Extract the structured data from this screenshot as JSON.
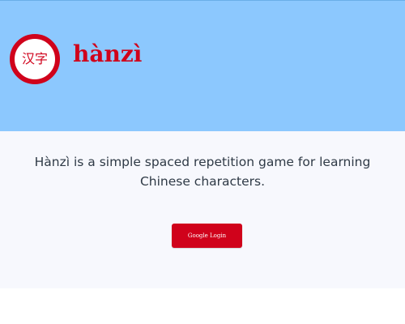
{
  "header": {
    "logo_text": "汉字",
    "brand_name": "hànzì"
  },
  "main": {
    "description": "Hànzì is a simple spaced repetition game for learning Chinese characters.",
    "login_button_label": "Google Login"
  },
  "colors": {
    "header_background": "#8cc8fe",
    "brand_red": "#d0021b",
    "main_background": "#f7f8fd",
    "text": "#2f3a46"
  }
}
